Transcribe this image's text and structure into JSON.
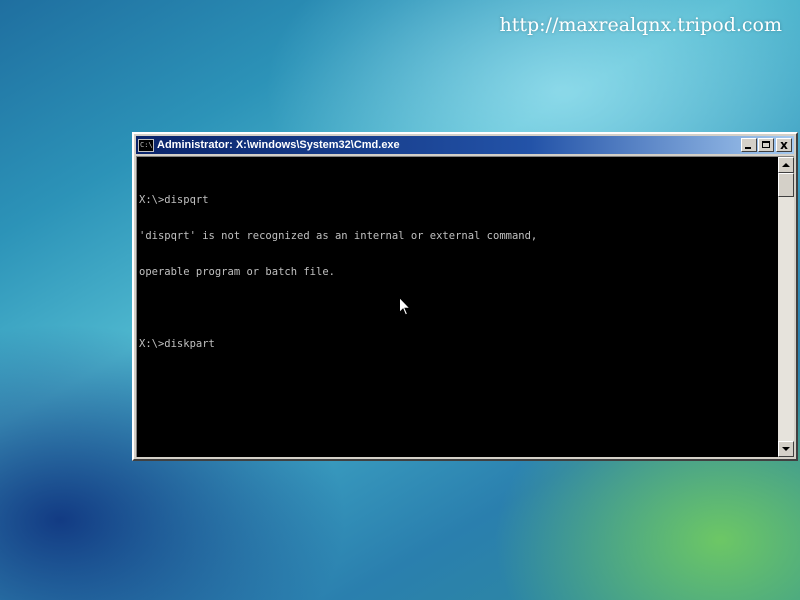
{
  "desktop": {
    "watermark": "http://maxrealqnx.tripod.com"
  },
  "window": {
    "title": "Administrator: X:\\windows\\System32\\Cmd.exe",
    "icon_text": "C:\\",
    "controls": {
      "minimize": "minimize-icon",
      "maximize": "maximize-icon",
      "close_label": "x"
    }
  },
  "console": {
    "lines": [
      "X:\\>dispqrt",
      "'dispqrt' is not recognized as an internal or external command,",
      "operable program or batch file.",
      "",
      "X:\\>diskpart"
    ]
  },
  "colors": {
    "console_bg": "#000000",
    "console_text": "#c0c0c0",
    "titlebar_start": "#0a246a",
    "titlebar_end": "#a6caf0",
    "window_frame": "#d4d0c8"
  }
}
